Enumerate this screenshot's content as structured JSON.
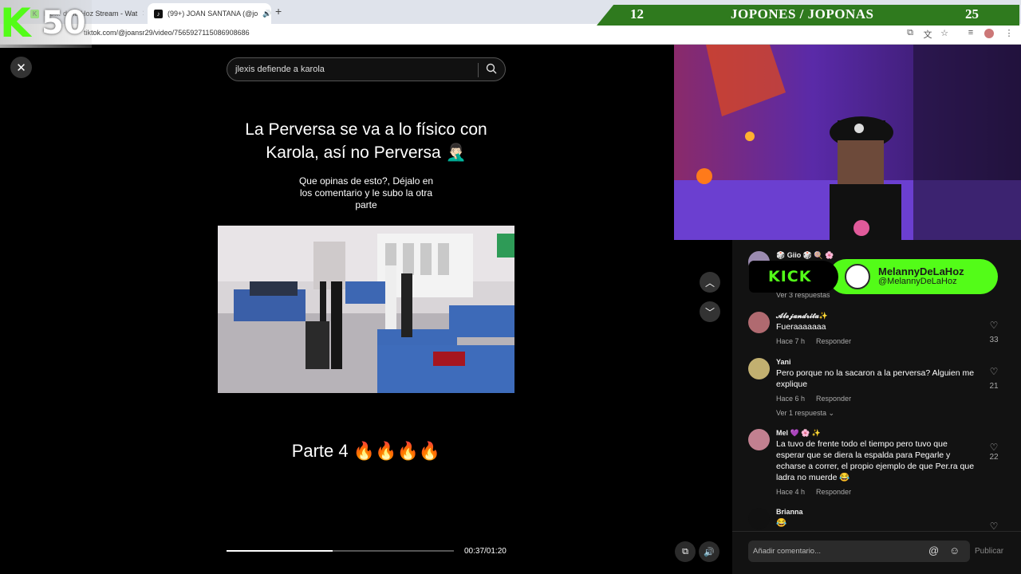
{
  "browser": {
    "tabs": [
      {
        "label": "Me… de la Hoz Stream - Wat",
        "active": false
      },
      {
        "label": "(99+) JOAN SANTANA (@jo",
        "active": true
      }
    ],
    "url": "tiktok.com/@joansr29/video/7565927115086908686"
  },
  "overlay": {
    "kick_counter": "50",
    "score_left": "12",
    "score_title": "JOPONES / JOPONAS",
    "score_right": "25"
  },
  "video": {
    "search_text": "jlexis defiende a karola",
    "headline": "La Perversa se va a lo físico con Karola, así no Perversa 🤦🏻‍♂️",
    "subline": "Que opinas de esto?, Déjalo en los comentario y le subo la otra parte",
    "parte": "Parte 4 🔥🔥🔥🔥",
    "time": "00:37/01:20",
    "progress": 0.466
  },
  "kick_badge": {
    "logo": "KICK",
    "name": "MelannyDeLaHoz",
    "handle": "@MelannyDeLaHoz"
  },
  "comments": [
    {
      "user": "🎲 Giio 🎲 🍭 🌸",
      "more": "Ver 3 respuestas"
    },
    {
      "user": "𝓐𝓵𝓮𝓳𝓪𝓷𝓭𝓻𝓲𝓽𝓪✨",
      "text": "Fueraaaaaaa",
      "time": "Hace 7 h",
      "reply": "Responder",
      "likes": "33"
    },
    {
      "user": "Yani",
      "text": "Pero porque no la sacaron a la perversa? Alguien me explique",
      "time": "Hace 6 h",
      "reply": "Responder",
      "likes": "21",
      "more": "Ver 1 respuesta"
    },
    {
      "user": "Mel 💜 🌸 ✨",
      "text": "La tuvo de frente todo el tiempo pero tuvo que esperar que se diera la espalda para Pegarle y echarse a correr, el propio ejemplo de que Per.ra que ladra no muerde 😂",
      "time": "Hace 4 h",
      "reply": "Responder",
      "likes": "22"
    },
    {
      "user": "Brianna",
      "text": "😂"
    }
  ],
  "comment_input": {
    "placeholder": "Añadir comentario...",
    "publish": "Publicar"
  },
  "icons": [
    "close-icon",
    "search-icon",
    "chevron-up-icon",
    "chevron-down-icon",
    "heart-icon",
    "volume-icon",
    "mention-icon",
    "emoji-icon"
  ]
}
